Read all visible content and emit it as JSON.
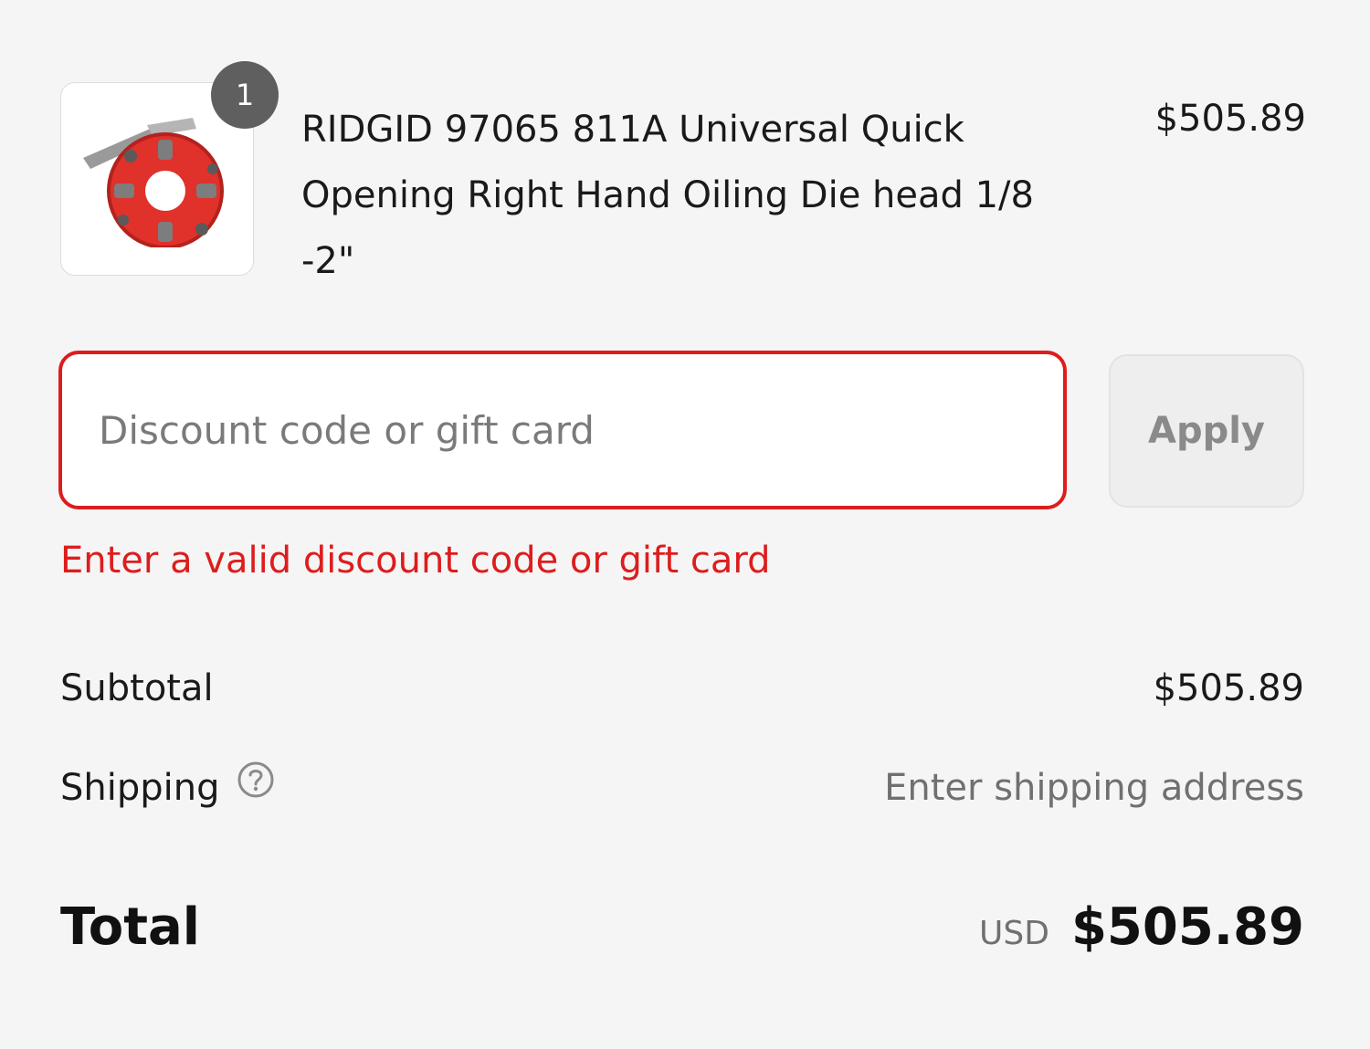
{
  "product": {
    "quantity": "1",
    "name": "RIDGID 97065 811A Universal Quick Opening Right Hand Oiling Die head 1/8 -2\"",
    "price": "$505.89",
    "thumbnail_icon": "die-head-product-image"
  },
  "discount": {
    "placeholder": "Discount code or gift card",
    "value": "",
    "apply_label": "Apply",
    "error": "Enter a valid discount code or gift card",
    "error_color": "#dd1d1d"
  },
  "summary": {
    "subtotal_label": "Subtotal",
    "subtotal_value": "$505.89",
    "shipping_label": "Shipping",
    "shipping_help_icon": "question-circle-icon",
    "shipping_value": "Enter shipping address",
    "total_label": "Total",
    "currency": "USD",
    "total_value": "$505.89"
  }
}
